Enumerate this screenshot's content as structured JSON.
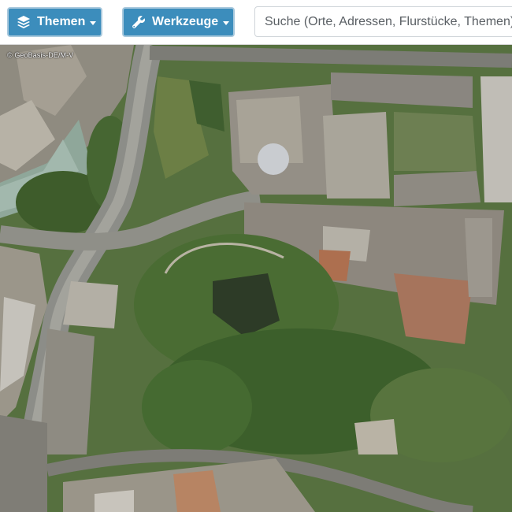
{
  "toolbar": {
    "themes_label": "Themen",
    "tools_label": "Werkzeuge",
    "search_placeholder": "Suche (Orte, Adressen, Flurstücke, Themen)"
  },
  "map": {
    "attribution": "© GeoBasis-DE/M-V",
    "layer": "aerial-orthophoto"
  },
  "icons": {
    "themes": "layers-icon",
    "tools": "wrench-icon",
    "dropdown": "caret-down-icon"
  },
  "colors": {
    "button_bg": "#3c8dbc",
    "button_border": "#a9c9dd",
    "button_text": "#ffffff"
  }
}
